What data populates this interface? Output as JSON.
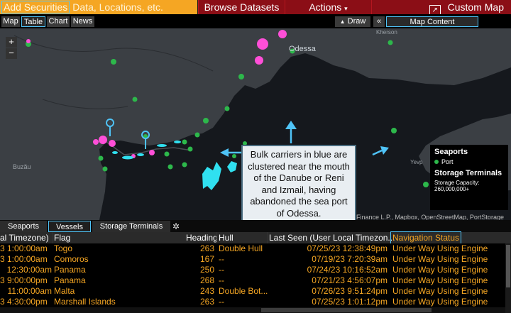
{
  "topbar": {
    "search_highlight": "Add Securities",
    "search_rest": "Data, Locations, etc.",
    "browse_label": "Browse Datasets",
    "actions_label": "Actions",
    "actions_caret": "▾",
    "custom_map_label": "Custom Map",
    "custom_map_icon": "↗"
  },
  "view_tabs": [
    "Map",
    "Table",
    "Chart",
    "News"
  ],
  "selected_view": "Table",
  "draw_label": "Draw",
  "draw_icon": "▲",
  "collapse_icon": "«",
  "map_content_label": "Map Content",
  "zoom": {
    "in": "+",
    "out": "−"
  },
  "map": {
    "city_label": "Odessa",
    "place_labels": [
      "Buzău",
      "Kherson",
      "Yevp"
    ],
    "colors": {
      "land": "#3b3f44",
      "sea": "#15181d",
      "port": "#2db84b",
      "vessel": "#30e0f0",
      "cluster": "#ff4fd8",
      "pin": "#4fc3f7"
    }
  },
  "callout": {
    "text": "Bulk carriers in blue are clustered near the mouth of the Danube or Reni and Izmail, having abandoned the sea port of Odessa."
  },
  "legend": {
    "seaports_title": "Seaports",
    "port_label": "Port",
    "storage_title": "Storage Terminals",
    "capacity_label": "Storage Capacity:",
    "capacity_value": "260,000,000+"
  },
  "credit": "Finance L.P., Mapbox, OpenStreetMap, PortStorage",
  "data_tabs": [
    "Seaports",
    "Vessels",
    "Storage Terminals"
  ],
  "selected_data_tab": "Vessels",
  "gear_icon": "✲",
  "table": {
    "headers": [
      "al Timezone)",
      "Flag",
      "Heading",
      "Hull",
      "Last Seen (User Local Timezon...",
      "Navigation Status"
    ],
    "rows": [
      [
        "3 1:00:00am",
        "Togo",
        "263",
        "Double Hull",
        "07/25/23 12:38:49pm",
        "Under Way Using Engine"
      ],
      [
        "3 1:00:00am",
        "Comoros",
        "167",
        "--",
        "07/19/23 7:20:39am",
        "Under Way Using Engine"
      ],
      [
        "12:30:00am",
        "Panama",
        "250",
        "--",
        "07/24/23 10:16:52am",
        "Under Way Using Engine"
      ],
      [
        "3 9:00:00pm",
        "Panama",
        "268",
        "--",
        "07/21/23 4:56:07pm",
        "Under Way Using Engine"
      ],
      [
        "11:00:00am",
        "Malta",
        "243",
        "Double Bot...",
        "07/26/23 9:51:24pm",
        "Under Way Using Engine"
      ],
      [
        "3 4:30:00pm",
        "Marshall Islands",
        "263",
        "--",
        "07/25/23 1:01:12pm",
        "Under Way Using Engine"
      ]
    ]
  }
}
